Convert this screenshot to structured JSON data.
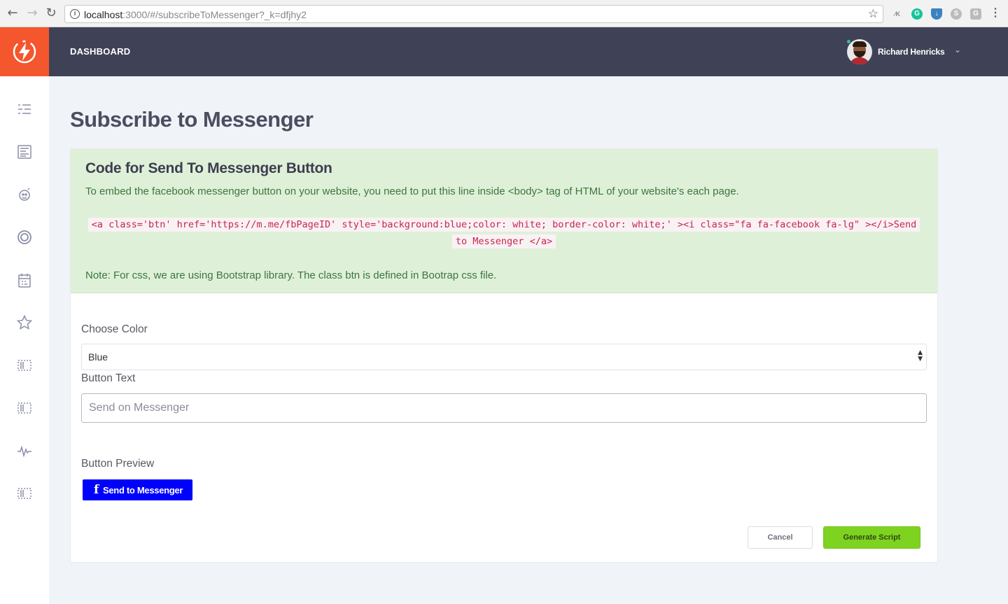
{
  "browser": {
    "url_host": "localhost",
    "url_rest": ":3000/#/subscribeToMessenger?_k=dfjhy2",
    "ext_label": "⁄K"
  },
  "header": {
    "dashboard_label": "DASHBOARD",
    "user_name": "Richard Henricks",
    "logo_color": "#f4562e",
    "bar_color": "#3f4257"
  },
  "sidebar": {
    "icons": [
      "list-icon",
      "newspaper-icon",
      "support-icon",
      "target-icon",
      "calendar-icon",
      "star-icon",
      "layout-icon",
      "layout-icon",
      "activity-icon",
      "layout-icon"
    ]
  },
  "page": {
    "title": "Subscribe to Messenger"
  },
  "alert": {
    "title": "Code for Send To Messenger Button",
    "text": "To embed the facebook messenger button on your website, you need to put this line inside <body> tag of HTML of your website's each page.",
    "code": "<a class='btn' href='https://m.me/fbPageID' style='background:blue;color: white; border-color: white;' ><i class=\"fa fa-facebook fa-lg\" ></i>Send to Messenger </a>",
    "note": "Note: For css, we are using Bootstrap library. The class btn is defined in Bootrap css file.",
    "bg_color": "#dff0d8"
  },
  "form": {
    "color_label": "Choose Color",
    "color_value": "Blue",
    "text_label": "Button Text",
    "text_placeholder": "Send on Messenger",
    "preview_label": "Button Preview",
    "preview_button_label": "Send to Messenger",
    "preview_button_color": "blue"
  },
  "actions": {
    "cancel_label": "Cancel",
    "generate_label": "Generate Script",
    "generate_color": "#7ed321"
  }
}
